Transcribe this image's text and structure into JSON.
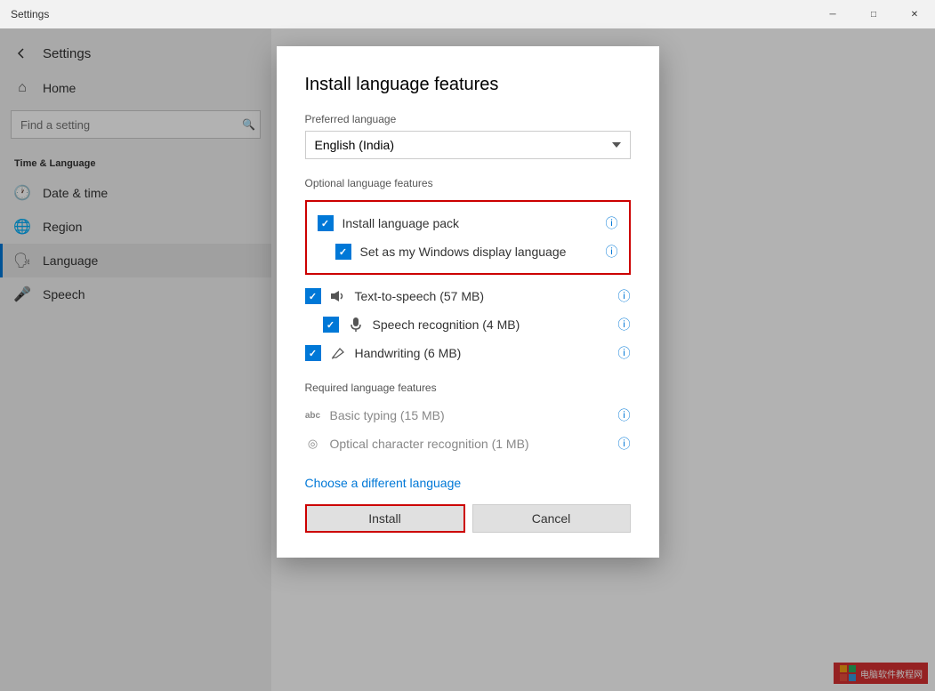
{
  "titleBar": {
    "title": "Settings",
    "minBtn": "─",
    "maxBtn": "□",
    "closeBtn": "✕"
  },
  "sidebar": {
    "appTitle": "Settings",
    "searchPlaceholder": "Find a setting",
    "sectionTitle": "Time & Language",
    "homeLabel": "Home",
    "items": [
      {
        "id": "date-time",
        "label": "Date & time"
      },
      {
        "id": "region",
        "label": "Region"
      },
      {
        "id": "language",
        "label": "Language"
      },
      {
        "id": "speech",
        "label": "Speech"
      }
    ]
  },
  "dialog": {
    "title": "Install language features",
    "preferredLanguageLabel": "Preferred language",
    "preferredLanguageValue": "English (India)",
    "optionalFeaturesLabel": "Optional language features",
    "features": [
      {
        "id": "lang-pack",
        "label": "Install language pack",
        "checked": true,
        "indented": false,
        "hasIcon": false
      },
      {
        "id": "display-lang",
        "label": "Set as my Windows display language",
        "checked": true,
        "indented": true,
        "hasIcon": false
      },
      {
        "id": "tts",
        "label": "Text-to-speech (57 MB)",
        "checked": true,
        "indented": false,
        "hasIcon": true,
        "iconSymbol": "🔊"
      },
      {
        "id": "speech-rec",
        "label": "Speech recognition (4 MB)",
        "checked": true,
        "indented": true,
        "hasIcon": true,
        "iconSymbol": "🎤"
      },
      {
        "id": "handwriting",
        "label": "Handwriting (6 MB)",
        "checked": true,
        "indented": false,
        "hasIcon": true,
        "iconSymbol": "✏"
      }
    ],
    "requiredFeaturesLabel": "Required language features",
    "requiredFeatures": [
      {
        "id": "basic-typing",
        "label": "Basic typing (15 MB)",
        "iconSymbol": "abc"
      },
      {
        "id": "ocr",
        "label": "Optical character recognition (1 MB)",
        "iconSymbol": "◎"
      }
    ],
    "chooseLinkLabel": "Choose a different language",
    "installBtn": "Install",
    "cancelBtn": "Cancel"
  }
}
